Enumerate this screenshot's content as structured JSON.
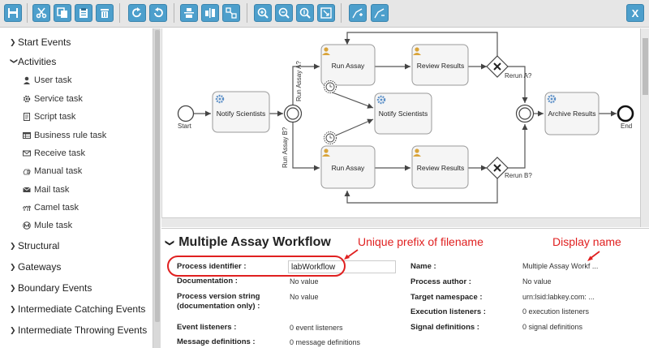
{
  "toolbar": {
    "buttons": [
      {
        "id": "save",
        "icon": "save-icon"
      },
      {
        "id": "cut",
        "icon": "scissors-icon"
      },
      {
        "id": "copy",
        "icon": "copy-icon"
      },
      {
        "id": "paste",
        "icon": "paste-icon"
      },
      {
        "id": "delete",
        "icon": "trash-icon"
      },
      {
        "id": "redo",
        "icon": "redo-icon"
      },
      {
        "id": "undo",
        "icon": "undo-icon"
      },
      {
        "id": "align-horizontal",
        "icon": "align-horizontal-icon"
      },
      {
        "id": "align-vertical",
        "icon": "align-vertical-icon"
      },
      {
        "id": "same-size",
        "icon": "same-size-icon"
      },
      {
        "id": "zoom-in",
        "icon": "zoom-in-icon"
      },
      {
        "id": "zoom-out",
        "icon": "zoom-out-icon"
      },
      {
        "id": "zoom-actual",
        "icon": "zoom-actual-icon"
      },
      {
        "id": "zoom-fit",
        "icon": "zoom-fit-icon"
      },
      {
        "id": "bend-add",
        "icon": "bendpoint-add-icon"
      },
      {
        "id": "bend-remove",
        "icon": "bendpoint-remove-icon"
      },
      {
        "id": "close",
        "icon": "close-x-icon"
      }
    ],
    "close_label": "X"
  },
  "sidebar": {
    "groups": [
      {
        "label": "Start Events",
        "expanded": false
      },
      {
        "label": "Activities",
        "expanded": true,
        "items": [
          {
            "label": "User task",
            "icon": "user-icon"
          },
          {
            "label": "Service task",
            "icon": "gear-icon"
          },
          {
            "label": "Script task",
            "icon": "script-icon"
          },
          {
            "label": "Business rule task",
            "icon": "table-icon"
          },
          {
            "label": "Receive task",
            "icon": "envelope-icon"
          },
          {
            "label": "Manual task",
            "icon": "hand-icon"
          },
          {
            "label": "Mail task",
            "icon": "mail-icon"
          },
          {
            "label": "Camel task",
            "icon": "camel-icon"
          },
          {
            "label": "Mule task",
            "icon": "mule-icon"
          }
        ]
      },
      {
        "label": "Structural",
        "expanded": false
      },
      {
        "label": "Gateways",
        "expanded": false
      },
      {
        "label": "Boundary Events",
        "expanded": false
      },
      {
        "label": "Intermediate Catching Events",
        "expanded": false
      },
      {
        "label": "Intermediate Throwing Events",
        "expanded": false
      }
    ]
  },
  "diagram": {
    "start_label": "Start",
    "end_label": "End",
    "notify_scientists_1": "Notify Scientists",
    "notify_scientists_2": "Notify Scientists",
    "run_assay_top": "Run Assay",
    "run_assay_bottom": "Run Assay",
    "review_results_top": "Review Results",
    "review_results_bottom": "Review Results",
    "archive_results": "Archive Results",
    "flow_run_assay_a": "Run Assay A?",
    "flow_run_assay_b": "Run Assay B?",
    "flow_rerun_a": "Rerun A?",
    "flow_rerun_b": "Rerun B?"
  },
  "properties": {
    "title": "Multiple Assay Workflow",
    "left": [
      {
        "label": "Process identifier :",
        "value": "labWorkflow"
      },
      {
        "label": "Documentation :",
        "value": "No value"
      },
      {
        "label": "Process version string\n(documentation only) :",
        "label_line1": "Process version string",
        "label_line2": "(documentation only) :",
        "value": "No value"
      },
      {
        "label": "Event listeners :",
        "value": "0 event listeners"
      },
      {
        "label": "Message definitions :",
        "value": "0 message definitions"
      }
    ],
    "right": [
      {
        "label": "Name :",
        "value": "Multiple Assay Workf ..."
      },
      {
        "label": "Process author :",
        "value": "No value"
      },
      {
        "label": "Target namespace :",
        "value": "urn:lsid:labkey.com: ..."
      },
      {
        "label": "Execution listeners :",
        "value": "0 execution listeners"
      },
      {
        "label": "Signal definitions :",
        "value": "0 signal definitions"
      }
    ]
  },
  "annotations": {
    "unique_prefix": "Unique prefix of filename",
    "display_name": "Display name"
  },
  "colors": {
    "toolbar_button": "#4d9fcc",
    "annotation": "#e02020",
    "task_fill": "#f5f5f5",
    "task_border": "#9a9a9a",
    "user_icon": "#d9a43a",
    "gear_icon": "#5b8fc7"
  }
}
